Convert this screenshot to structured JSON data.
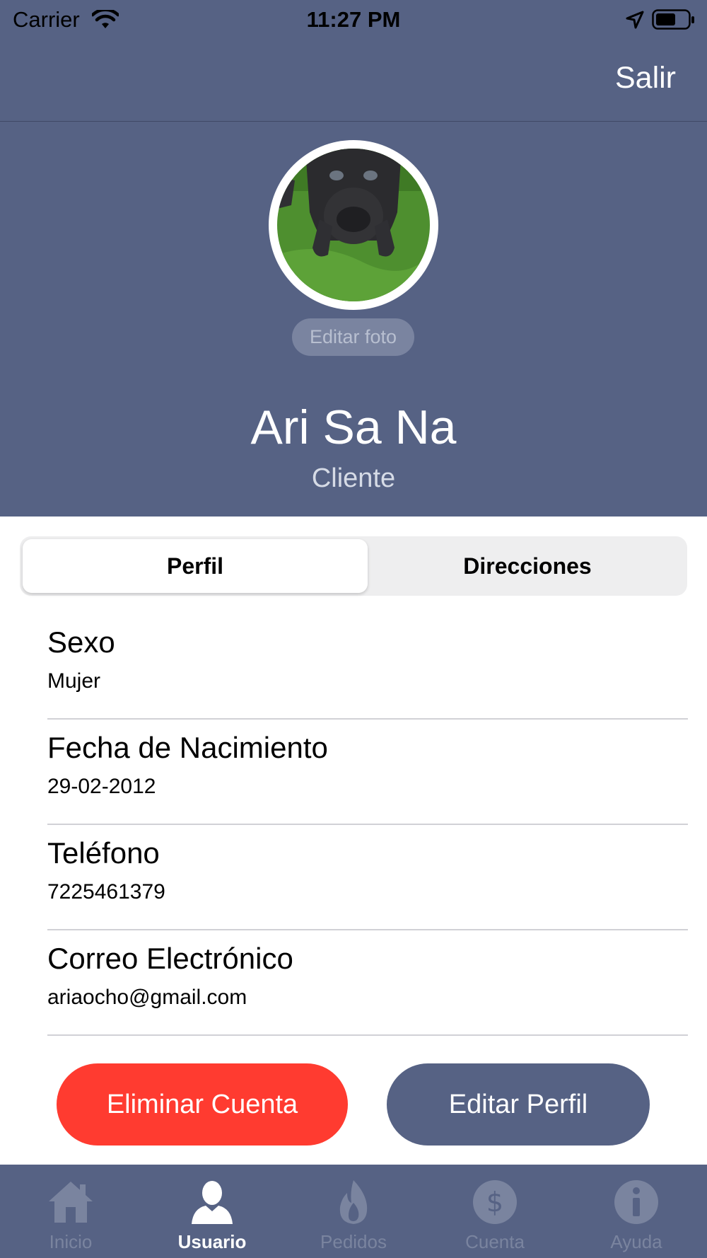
{
  "status_bar": {
    "carrier": "Carrier",
    "time": "11:27 PM"
  },
  "nav": {
    "logout_label": "Salir"
  },
  "profile": {
    "edit_photo_label": "Editar foto",
    "name": "Ari Sa Na",
    "role": "Cliente"
  },
  "segments": {
    "profile_label": "Perfil",
    "addresses_label": "Direcciones",
    "selected": "Perfil"
  },
  "fields": [
    {
      "label": "Sexo",
      "value": "Mujer"
    },
    {
      "label": "Fecha de Nacimiento",
      "value": "29-02-2012"
    },
    {
      "label": "Teléfono",
      "value": "7225461379"
    },
    {
      "label": "Correo Electrónico",
      "value": "ariaocho@gmail.com"
    }
  ],
  "actions": {
    "delete_label": "Eliminar Cuenta",
    "edit_label": "Editar Perfil"
  },
  "tabbar": {
    "items": [
      {
        "label": "Inicio",
        "icon": "home-icon"
      },
      {
        "label": "Usuario",
        "icon": "user-icon"
      },
      {
        "label": "Pedidos",
        "icon": "flame-icon"
      },
      {
        "label": "Cuenta",
        "icon": "dollar-icon"
      },
      {
        "label": "Ayuda",
        "icon": "info-icon"
      }
    ],
    "active": "Usuario"
  },
  "colors": {
    "primary": "#566284",
    "danger": "#ff3b30",
    "tab_inactive": "#7a849f"
  }
}
